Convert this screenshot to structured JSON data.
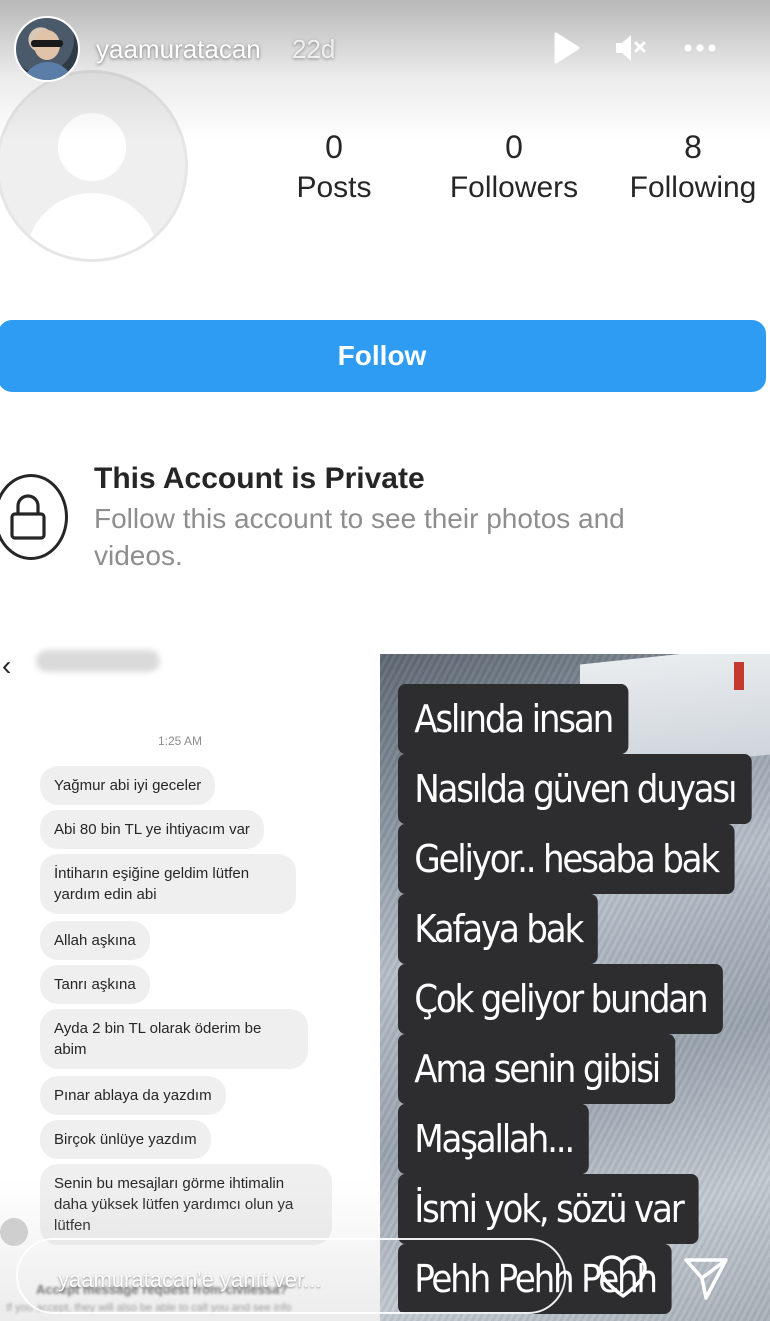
{
  "story": {
    "username": "yaamuratacan",
    "time_ago": "22d",
    "play_icon": "play-icon",
    "mute_icon": "speaker-muted-icon",
    "more_icon": "more-horizontal-icon"
  },
  "profile": {
    "stats": [
      {
        "value": "0",
        "label": "Posts"
      },
      {
        "value": "0",
        "label": "Followers"
      },
      {
        "value": "8",
        "label": "Following"
      }
    ],
    "follow_label": "Follow",
    "follow_color": "#2e9cf3",
    "private_title": "This Account is Private",
    "private_subtitle": "Follow this account to see their photos and videos."
  },
  "chat": {
    "time": "1:25 AM",
    "messages": [
      "Yağmur abi iyi geceler",
      "Abi 80 bin TL ye ihtiyacım var",
      "İntiharın eşiğine geldim lütfen yardım edin abi",
      "Allah aşkına",
      "Tanrı aşkına",
      "Ayda 2 bin TL olarak öderim be abim",
      "Pınar ablaya da yazdım",
      "Birçok ünlüye yazdım",
      "Senin bu mesajları görme ihtimalin daha yüksek lütfen yardımcı olun ya lütfen"
    ],
    "footer_title": "Accept message request from civilessa?",
    "footer_sub": "If you accept, they will also be able to call you and see info"
  },
  "captions": [
    "Aslında insan",
    "Nasılda güven duyası",
    "Geliyor.. hesaba bak",
    "Kafaya bak",
    "Çok geliyor bundan",
    "Ama senin gibisi",
    "Maşallah...",
    "İsmi yok, sözü var",
    "Pehh Pehh Pehh"
  ],
  "reply": {
    "placeholder": "yaamuratacan'e yanıt ver...",
    "heart_icon": "heart-icon",
    "send_icon": "send-icon"
  }
}
